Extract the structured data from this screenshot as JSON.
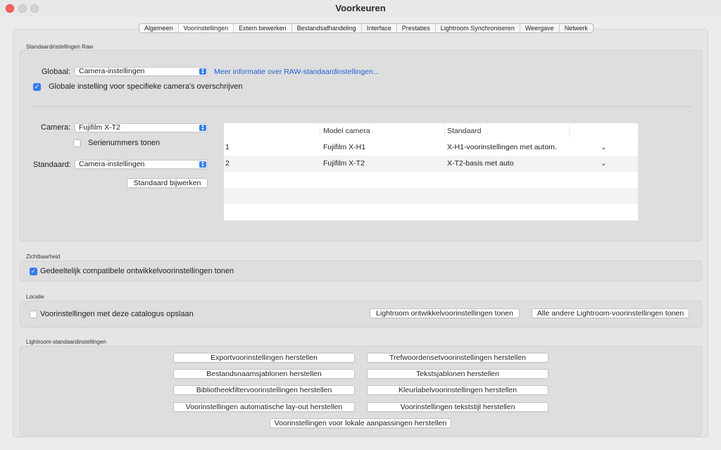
{
  "window": {
    "title": "Voorkeuren"
  },
  "tabs": [
    "Algemeen",
    "Voorinstellingen",
    "Extern bewerken",
    "Bestandsafhandeling",
    "Interface",
    "Prestaties",
    "Lightroom Synchroniseren",
    "Weergave",
    "Netwerk"
  ],
  "active_tab": "Voorinstellingen",
  "raw": {
    "section_label": "Standaardinstellingen Raw",
    "global_label": "Globaal:",
    "global_value": "Camera-instellingen",
    "more_info_link": "Meer informatie over RAW-standaardinstellingen...",
    "override_label": "Globale instelling voor specifieke camera's overschrijven",
    "override_checked": true,
    "camera_label": "Camera:",
    "camera_value": "Fujifilm X-T2",
    "serial_label": "Serienummers tonen",
    "serial_checked": false,
    "standard_label": "Standaard:",
    "standard_value": "Camera-instellingen",
    "update_button": "Standaard bijwerken",
    "table": {
      "headers": [
        "",
        "Model camera",
        "Standaard",
        ""
      ],
      "rows": [
        {
          "num": "1",
          "model": "Fujifilm X-H1",
          "standard": "X-H1-voorinstellingen met autom."
        },
        {
          "num": "2",
          "model": "Fujifilm X-T2",
          "standard": "X-T2-basis met auto"
        }
      ]
    }
  },
  "visibility": {
    "section_label": "Zichtbaarheid",
    "partial_label": "Gedeeltelijk compatibele ontwikkelvoorinstellingen tonen",
    "partial_checked": true
  },
  "location": {
    "section_label": "Locatie",
    "store_label": "Voorinstellingen met deze catalogus opslaan",
    "store_checked": false,
    "show_develop_button": "Lightroom ontwikkelvoorinstellingen tonen",
    "show_all_button": "Alle andere Lightroom-voorinstellingen tonen"
  },
  "defaults": {
    "section_label": "Lightroom-standaardinstellingen",
    "buttons": [
      "Exportvoorinstellingen herstellen",
      "Trefwoordensetvoorinstellingen herstellen",
      "Bestandsnaamsjablonen herstellen",
      "Tekstsjablonen herstellen",
      "Bibliotheekfiltervoorinstellingen herstellen",
      "Kleurlabelvoorinstellingen herstellen",
      "Voorinstellingen automatische lay-out herstellen",
      "Voorinstellingen tekststijl herstellen",
      "Voorinstellingen voor lokale aanpassingen herstellen"
    ]
  },
  "colors": {
    "accent": "#2f7cf6",
    "link": "#1f5fd6",
    "close": "#fe5f57"
  }
}
